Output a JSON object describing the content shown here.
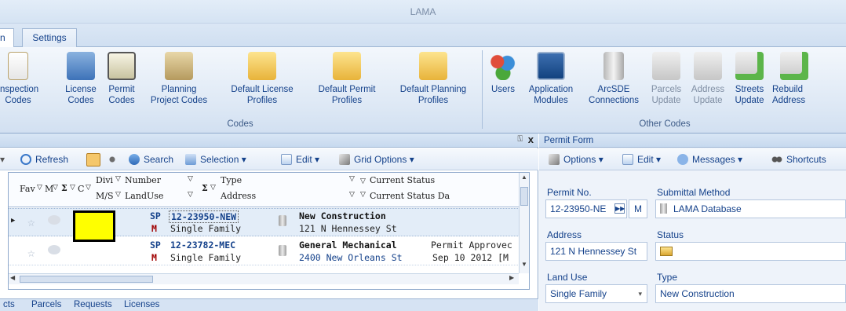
{
  "window": {
    "title": "LAMA"
  },
  "ribbon_tabs": {
    "partial": "n",
    "settings": "Settings"
  },
  "ribbon": {
    "codes_group": {
      "label": "Codes",
      "items": [
        {
          "line1": "Inspection",
          "line2": "Codes",
          "icon": "document-icon"
        },
        {
          "line1": "License",
          "line2": "Codes",
          "icon": "card-icon"
        },
        {
          "line1": "Permit",
          "line2": "Codes",
          "icon": "certificate-icon"
        },
        {
          "line1": "Planning",
          "line2": "Project Codes",
          "icon": "box-icon"
        },
        {
          "line1": "Default License",
          "line2": "Profiles",
          "icon": "folder-icon"
        },
        {
          "line1": "Default Permit",
          "line2": "Profiles",
          "icon": "folder-icon"
        },
        {
          "line1": "Default Planning",
          "line2": "Profiles",
          "icon": "folder-icon"
        }
      ]
    },
    "other_group": {
      "label": "Other Codes",
      "items": [
        {
          "line1": "Users",
          "line2": "",
          "icon": "users-icon"
        },
        {
          "line1": "Application",
          "line2": "Modules",
          "icon": "app-module-icon"
        },
        {
          "line1": "ArcSDE",
          "line2": "Connections",
          "icon": "database-icon"
        },
        {
          "line1": "Parcels",
          "line2": "Update",
          "icon": "update-icon",
          "disabled": true
        },
        {
          "line1": "Address",
          "line2": "Update",
          "icon": "update-icon",
          "disabled": true
        },
        {
          "line1": "Streets",
          "line2": "Update",
          "icon": "update-icon"
        },
        {
          "line1": "Rebuild",
          "line2": "Address",
          "icon": "rebuild-icon"
        }
      ]
    }
  },
  "left_pane": {
    "header": {
      "pin": "\u0000",
      "close": "x"
    },
    "toolbar": {
      "refresh": "Refresh",
      "search": "Search",
      "selection": "Selection ▾",
      "edit": "Edit ▾",
      "grid_options": "Grid Options ▾"
    },
    "grid": {
      "headers": {
        "fav": "Fav",
        "m": "M",
        "sigma": "Σ",
        "c": "C",
        "divi": "Divi",
        "number": "Number",
        "ms": "M/S",
        "landuse": "LandUse",
        "type": "Type",
        "address": "Address",
        "current_status": "Current Status",
        "current_status_date": "Current Status Da"
      },
      "rows": [
        {
          "divi": "SP",
          "ms": "M",
          "number": "12-23950-NEW",
          "landuse": "Single Family",
          "type": "New Construction",
          "address": "121 N Hennessey St",
          "status": "",
          "status_date": ""
        },
        {
          "divi": "SP",
          "ms": "M",
          "number": "12-23782-MEC",
          "landuse": "Single Family",
          "type": "General Mechanical",
          "address": "2400 New Orleans St",
          "status": "Permit Approvec",
          "status_date": "Sep 10 2012 [M"
        }
      ]
    },
    "bottom_tabs": [
      "cts",
      "Parcels",
      "Requests",
      "Licenses"
    ]
  },
  "right_pane": {
    "title": "Permit Form",
    "toolbar": {
      "options": "Options ▾",
      "edit": "Edit ▾",
      "messages": "Messages ▾",
      "shortcuts": "Shortcuts"
    },
    "fields": {
      "permit_no_label": "Permit No.",
      "permit_no_value": "12-23950-NE",
      "m_button": "M",
      "submittal_method_label": "Submittal Method",
      "submittal_method_value": "LAMA Database",
      "address_label": "Address",
      "address_value": "121 N Hennessey St",
      "status_label": "Status",
      "landuse_label": "Land Use",
      "landuse_value": "Single Family",
      "type_label": "Type",
      "type_value": "New Construction"
    }
  }
}
